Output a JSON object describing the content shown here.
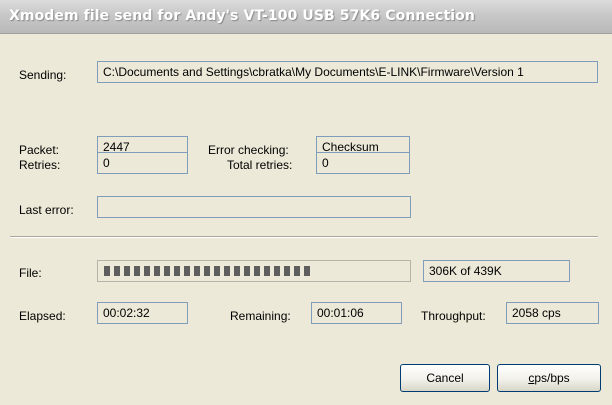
{
  "window": {
    "title": "Xmodem file send for Andy's VT-100 USB 57K6 Connection"
  },
  "sending": {
    "label": "Sending:",
    "value": "C:\\Documents and Settings\\cbratka\\My Documents\\E-LINK\\Firmware\\Version 1"
  },
  "packet": {
    "label": "Packet:",
    "value": "2447"
  },
  "error_checking": {
    "label": "Error checking:",
    "value": "Checksum"
  },
  "retries": {
    "label": "Retries:",
    "value": "0"
  },
  "total_retries": {
    "label": "Total retries:",
    "value": "0"
  },
  "last_error": {
    "label": "Last error:",
    "value": ""
  },
  "file": {
    "label": "File:",
    "progress_fraction": 0.7,
    "progress_text": "306K of 439K"
  },
  "elapsed": {
    "label": "Elapsed:",
    "value": "00:02:32"
  },
  "remaining": {
    "label": "Remaining:",
    "value": "00:01:06"
  },
  "throughput": {
    "label": "Throughput:",
    "value": "2058 cps"
  },
  "buttons": {
    "cancel": "Cancel",
    "cps_first": "c",
    "cps_rest": "ps/bps"
  }
}
